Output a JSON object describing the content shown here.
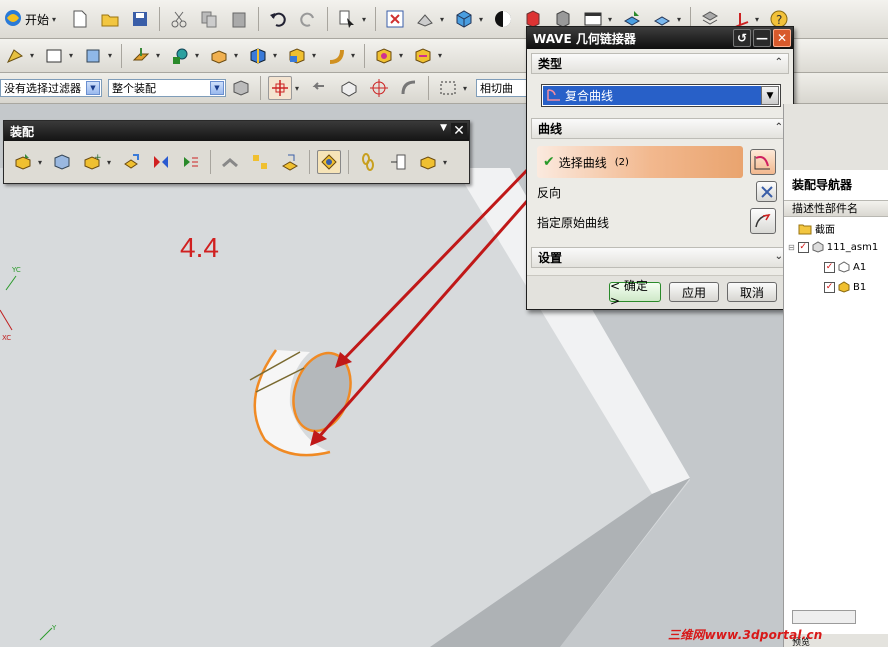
{
  "toolbar": {
    "start_label": "开始",
    "filter_value": "没有选择过滤器",
    "scope_value": "整个装配",
    "snap_value": "相切曲"
  },
  "graphics": {
    "annotation": "4.4",
    "axis_yc": "YC",
    "axis_xc": "XC",
    "axis_y": "Y"
  },
  "assembly_toolbar": {
    "title": "装配"
  },
  "wave_dialog": {
    "title": "WAVE 几何链接器",
    "type_section": "类型",
    "type_value": "复合曲线",
    "curve_section": "曲线",
    "select_curve_label": "选择曲线",
    "select_curve_count": "(2)",
    "reverse_label": "反向",
    "specify_curve_label": "指定原始曲线",
    "settings_section": "设置",
    "ok_label": "< 确定 >",
    "apply_label": "应用",
    "cancel_label": "取消"
  },
  "navigator": {
    "title": "装配导航器",
    "column_header": "描述性部件名",
    "items": [
      {
        "label": "截面"
      },
      {
        "label": "111_asm1"
      },
      {
        "label": "A1"
      },
      {
        "label": "B1"
      }
    ],
    "bottom_label": "预览"
  },
  "watermark": "三维网www.3dportal.cn",
  "colors": {
    "dialog_title_bg": "#141414",
    "selection_highlight": "#2860c8",
    "active_row": "#f2b88e",
    "close_button": "#d85a2c",
    "arrow_red": "#c01818",
    "edge_orange": "#f08a24"
  }
}
